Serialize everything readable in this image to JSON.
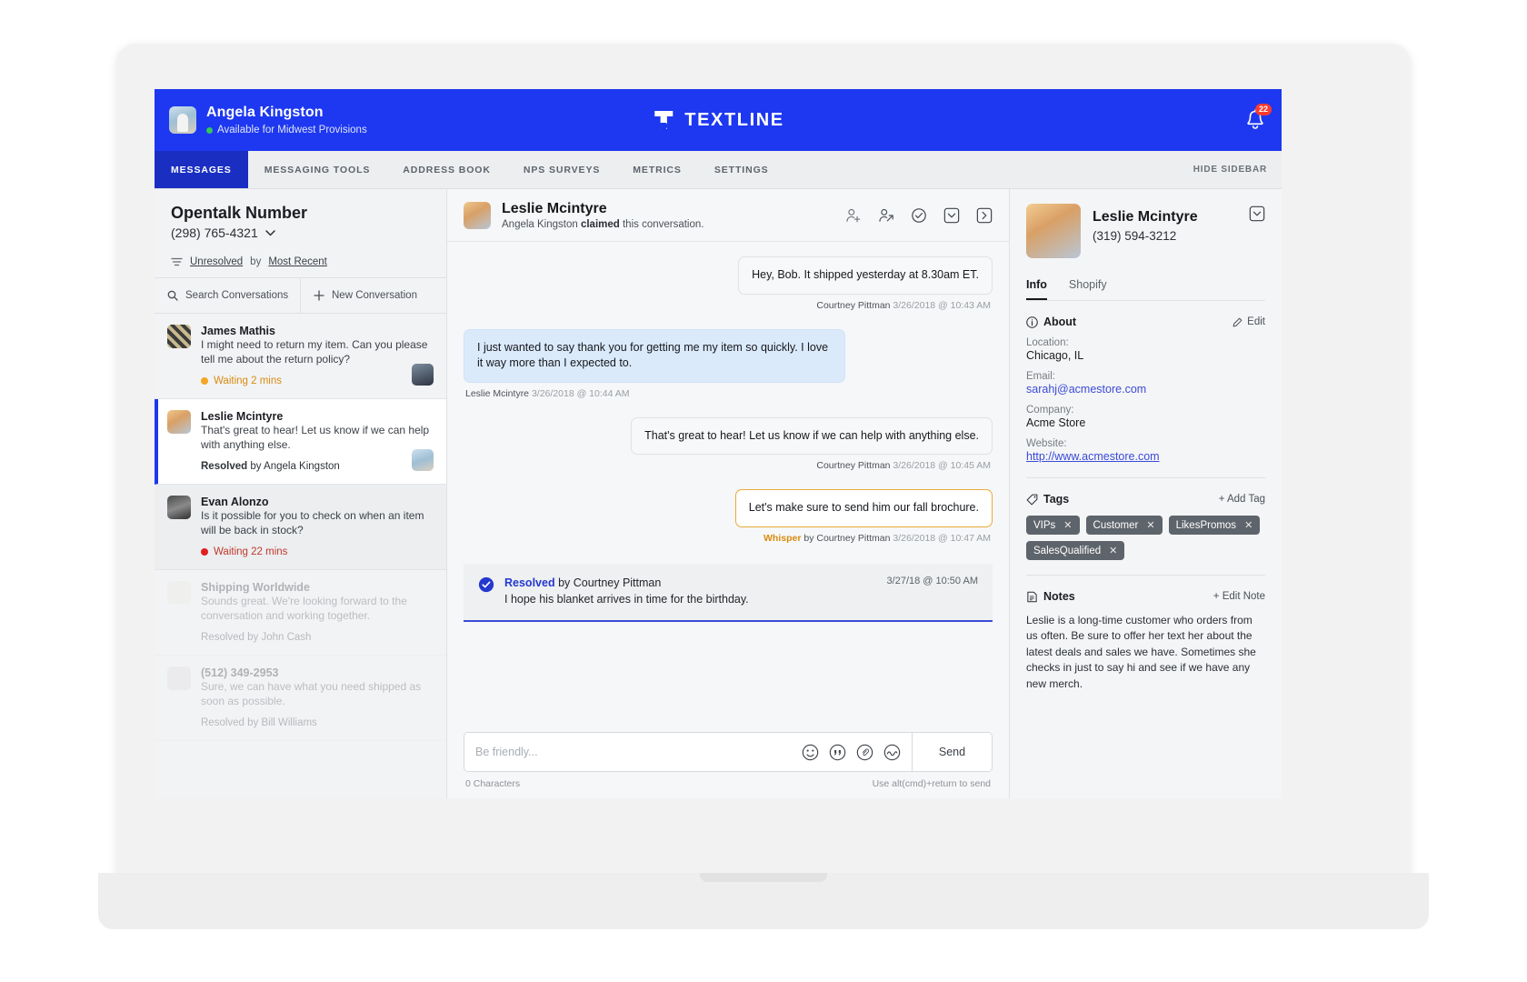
{
  "topbar": {
    "user_name": "Angela Kingston",
    "user_status": "Available for Midwest Provisions",
    "brand_name": "TEXTLINE",
    "notification_count": "22",
    "avatar_icon": "user-avatar",
    "bell_icon": "bell-icon"
  },
  "nav": {
    "items": [
      {
        "label": "MESSAGES",
        "active": true
      },
      {
        "label": "MESSAGING TOOLS",
        "active": false
      },
      {
        "label": "ADDRESS BOOK",
        "active": false
      },
      {
        "label": "NPS SURVEYS",
        "active": false
      },
      {
        "label": "METRICS",
        "active": false
      },
      {
        "label": "SETTINGS",
        "active": false
      }
    ],
    "hide_sidebar": "HIDE SIDEBAR"
  },
  "inbox": {
    "title": "Opentalk Number",
    "phone": "(298) 765-4321",
    "filter_prefix": "Unresolved",
    "filter_by": "by",
    "filter_sort": "Most Recent",
    "search_label": "Search Conversations",
    "new_label": "New Conversation",
    "conversations": [
      {
        "name": "James Mathis",
        "preview": "I might need to return my item. Can you please tell me about the return policy?",
        "status_label": "Waiting",
        "status_value": "2 mins",
        "status_type": "waiting-orange"
      },
      {
        "name": "Leslie Mcintyre",
        "preview": "That's great to hear! Let us know if we can help with anything else.",
        "status_label": "Resolved",
        "status_value": "by Angela Kingston",
        "status_type": "resolved"
      },
      {
        "name": "Evan Alonzo",
        "preview": "Is it possible for you to check on when an item will be back in stock?",
        "status_label": "Waiting",
        "status_value": "22 mins",
        "status_type": "waiting-red"
      },
      {
        "name": "Shipping Worldwide",
        "preview": "Sounds great. We're looking forward to the conversation and working together.",
        "status_label": "Resolved by John Cash",
        "status_value": "",
        "status_type": "faded"
      },
      {
        "name": "(512) 349-2953",
        "preview": "Sure, we can have what you need shipped as soon as possible.",
        "status_label": "Resolved by Bill Williams",
        "status_value": "",
        "status_type": "faded"
      }
    ]
  },
  "conversation": {
    "title": "Leslie Mcintyre",
    "subtitle_pre": "Angela Kingston ",
    "subtitle_bold": "claimed",
    "subtitle_post": " this conversation.",
    "action_icons": [
      "add-user-icon",
      "transfer-user-icon",
      "resolve-check-icon",
      "collapse-icon",
      "next-icon"
    ],
    "messages": [
      {
        "direction": "out",
        "kind": "normal",
        "text": "Hey, Bob. It shipped yesterday at 8.30am ET.",
        "author": "Courtney Pittman",
        "timestamp": "3/26/2018 @ 10:43 AM"
      },
      {
        "direction": "in",
        "kind": "normal",
        "text": "I just wanted to say thank you for getting me my item so quickly. I love it way more than I expected to.",
        "author": "Leslie Mcintyre",
        "timestamp": "3/26/2018 @ 10:44 AM"
      },
      {
        "direction": "out",
        "kind": "normal",
        "text": "That's great to hear! Let us know if we can help with anything else.",
        "author": "Courtney Pittman",
        "timestamp": "3/26/2018 @ 10:45 AM"
      },
      {
        "direction": "out",
        "kind": "whisper",
        "text": "Let's make sure to send him our fall brochure.",
        "whisper_tag": "Whisper",
        "author_pre": "by Courtney Pittman",
        "timestamp": "3/26/2018 @ 10:47 AM"
      }
    ],
    "resolved_bar": {
      "icon": "check-circle-icon",
      "label": "Resolved",
      "by": "by Courtney Pittman",
      "note": "I hope his blanket arrives in time for the birthday.",
      "timestamp": "3/27/18 @ 10:50 AM"
    },
    "composer": {
      "placeholder": "Be friendly...",
      "value": "",
      "icons": [
        "emoji-icon",
        "quote-icon",
        "attachment-icon",
        "signature-icon"
      ],
      "send_label": "Send",
      "char_count": "0 Characters",
      "hint": "Use alt(cmd)+return to send"
    }
  },
  "contact_panel": {
    "name": "Leslie Mcintyre",
    "phone": "(319) 594-3212",
    "tabs": [
      {
        "label": "Info",
        "active": true
      },
      {
        "label": "Shopify",
        "active": false
      }
    ],
    "about": {
      "title": "About",
      "edit_label": "Edit",
      "fields": [
        {
          "label": "Location:",
          "value": "Chicago, IL",
          "is_link": false
        },
        {
          "label": "Email:",
          "value": "sarahj@acmestore.com",
          "is_link": true
        },
        {
          "label": "Company:",
          "value": "Acme Store",
          "is_link": false
        },
        {
          "label": "Website:",
          "value": "http://www.acmestore.com",
          "is_link": true
        }
      ]
    },
    "tags_section": {
      "title": "Tags",
      "add_label": "+ Add Tag",
      "tags": [
        "VIPs",
        "Customer",
        "LikesPromos",
        "SalesQualified"
      ]
    },
    "notes_section": {
      "title": "Notes",
      "edit_label": "+ Edit Note",
      "body": "Leslie is a long-time customer who orders from us often. Be sure to offer her text her about the latest deals and sales we have. Sometimes she checks in just to say hi and see if we have any new merch."
    }
  },
  "colors": {
    "brand_blue": "#1d38f0",
    "nav_active": "#1a2fc2",
    "waiting_orange": "#d98c10",
    "waiting_red": "#d0021b",
    "whisper_gold": "#e8a93b",
    "link_blue": "#3b4bd8",
    "badge_red": "#ff3b30"
  }
}
